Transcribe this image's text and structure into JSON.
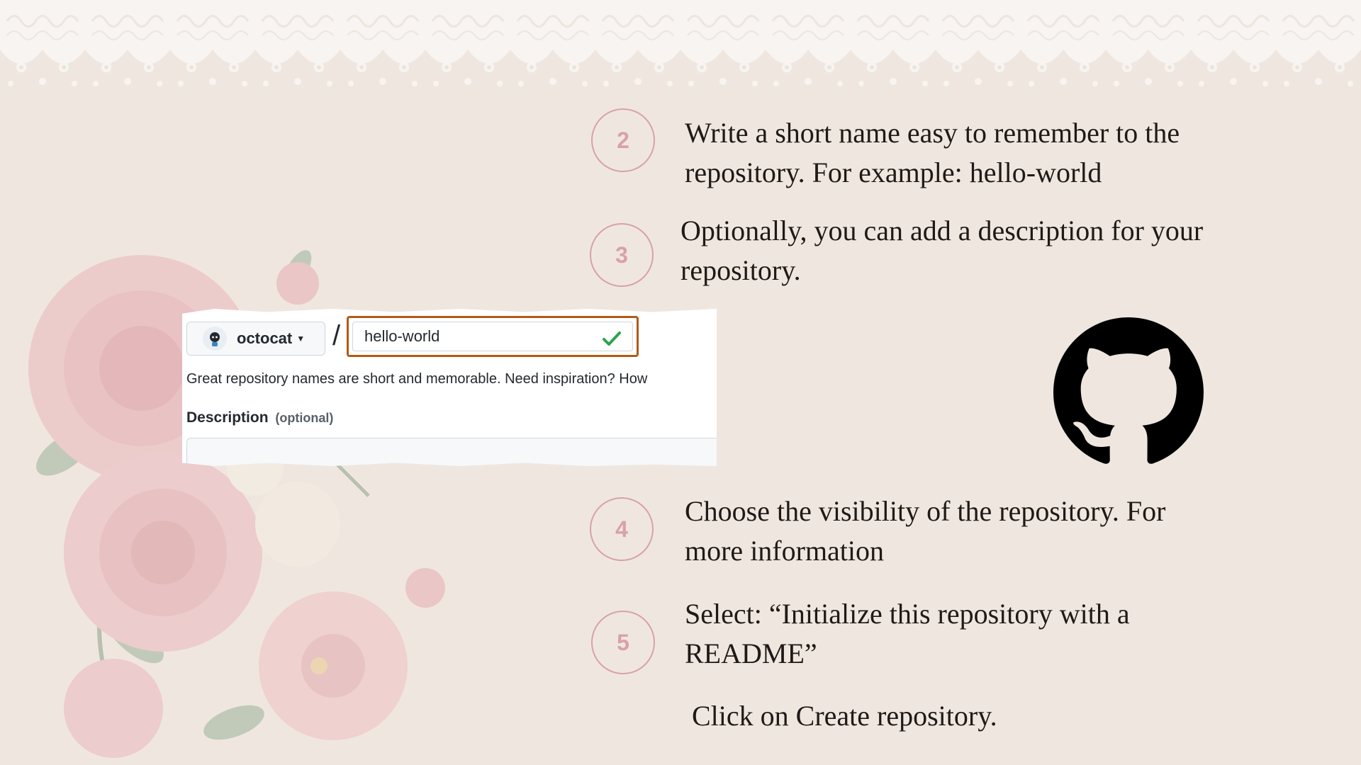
{
  "owner": {
    "name": "octocat"
  },
  "separator": "/",
  "repo_name": {
    "value": "hello-world"
  },
  "hint_text": "Great repository names are short and memorable. Need inspiration? How",
  "description": {
    "label": "Description",
    "optional": "(optional)",
    "value": ""
  },
  "steps": [
    {
      "number": "2",
      "text": "Write a short name easy to remember to the repository. For example: hello-world"
    },
    {
      "number": "3",
      "text": "Optionally, you can add a description for your repository."
    },
    {
      "number": "4",
      "text": "Choose the visibility of the repository. For more information"
    },
    {
      "number": "5",
      "text": "Select:  “Initialize this repository with a README”"
    }
  ],
  "final_text": "Click on Create repository.",
  "colors": {
    "background": "#efe7df",
    "accent_pink": "#d9a0ad",
    "input_highlight": "#b35a16",
    "check_green": "#2da44e"
  }
}
